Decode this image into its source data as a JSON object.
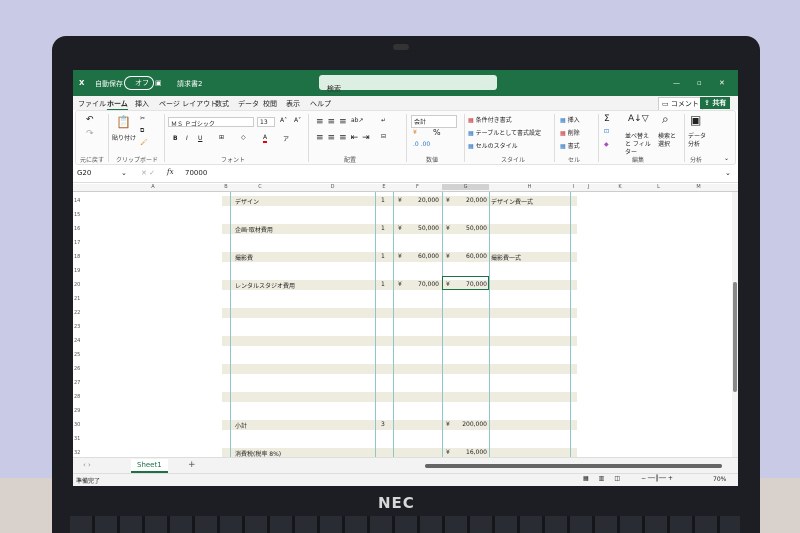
{
  "window": {
    "autosave_label": "自動保存",
    "autosave_state": "オフ",
    "doc_title": "請求書2",
    "search_placeholder": "検索",
    "minimize": "—",
    "restore": "▫",
    "close": "✕"
  },
  "tabs": [
    "ファイル",
    "ホーム",
    "挿入",
    "ページ レイアウト",
    "数式",
    "データ",
    "校閲",
    "表示",
    "ヘルプ"
  ],
  "comment_button": "コメント",
  "share_button": "共有",
  "ribbon": {
    "undo_group": "元に戻す",
    "paste": "貼り付け",
    "clipboard_group": "クリップボード",
    "font_name": "ＭＳ Ｐゴシック",
    "font_size": "13",
    "bold": "B",
    "italic": "I",
    "underline": "U",
    "font_group": "フォント",
    "align_group": "配置",
    "number_format": "会計",
    "percent": "%",
    "number_group": "数値",
    "cond_format": "条件付き書式",
    "table_format": "テーブルとして書式設定",
    "cell_style": "セルのスタイル",
    "style_group": "スタイル",
    "insert": "挿入",
    "delete": "削除",
    "format": "書式",
    "cells_group": "セル",
    "sum": "Σ",
    "sort_filter": "並べ替えと フィルター",
    "find_select": "検索と 選択",
    "edit_group": "編集",
    "data_analysis": "データ 分析",
    "analysis_group": "分析"
  },
  "formula_bar": {
    "name_box": "G20",
    "fx": "fx",
    "value": "70000"
  },
  "columns": [
    "A",
    "B",
    "C",
    "D",
    "E",
    "F",
    "G",
    "H",
    "I",
    "J",
    "K",
    "L",
    "M"
  ],
  "rows": [
    {
      "n": "14",
      "c": "デザイン",
      "e": "1",
      "f_cur": "¥",
      "f": "20,000",
      "g_cur": "¥",
      "g": "20,000",
      "h": "デザイン費一式"
    },
    {
      "n": "15"
    },
    {
      "n": "16",
      "c": "企画·取材費用",
      "e": "1",
      "f_cur": "¥",
      "f": "50,000",
      "g_cur": "¥",
      "g": "50,000"
    },
    {
      "n": "17"
    },
    {
      "n": "18",
      "c": "撮影費",
      "e": "1",
      "f_cur": "¥",
      "f": "60,000",
      "g_cur": "¥",
      "g": "60,000",
      "h": "撮影費一式"
    },
    {
      "n": "19"
    },
    {
      "n": "20",
      "c": "レンタルスタジオ費用",
      "e": "1",
      "f_cur": "¥",
      "f": "70,000",
      "g_cur": "¥",
      "g": "70,000"
    },
    {
      "n": "21"
    },
    {
      "n": "22"
    },
    {
      "n": "23"
    },
    {
      "n": "24"
    },
    {
      "n": "25"
    },
    {
      "n": "26"
    },
    {
      "n": "27"
    },
    {
      "n": "28"
    },
    {
      "n": "29"
    },
    {
      "n": "30",
      "c": "小計",
      "e": "3",
      "g_cur": "¥",
      "g": "200,000"
    },
    {
      "n": "31"
    },
    {
      "n": "32",
      "c": "消費税(税率 8%)",
      "g_cur": "¥",
      "g": "16,000"
    }
  ],
  "sheet_tab": "Sheet1",
  "add_sheet": "+",
  "status": {
    "text": "準備完了",
    "zoom": "70%"
  },
  "device_logo": "NEC"
}
